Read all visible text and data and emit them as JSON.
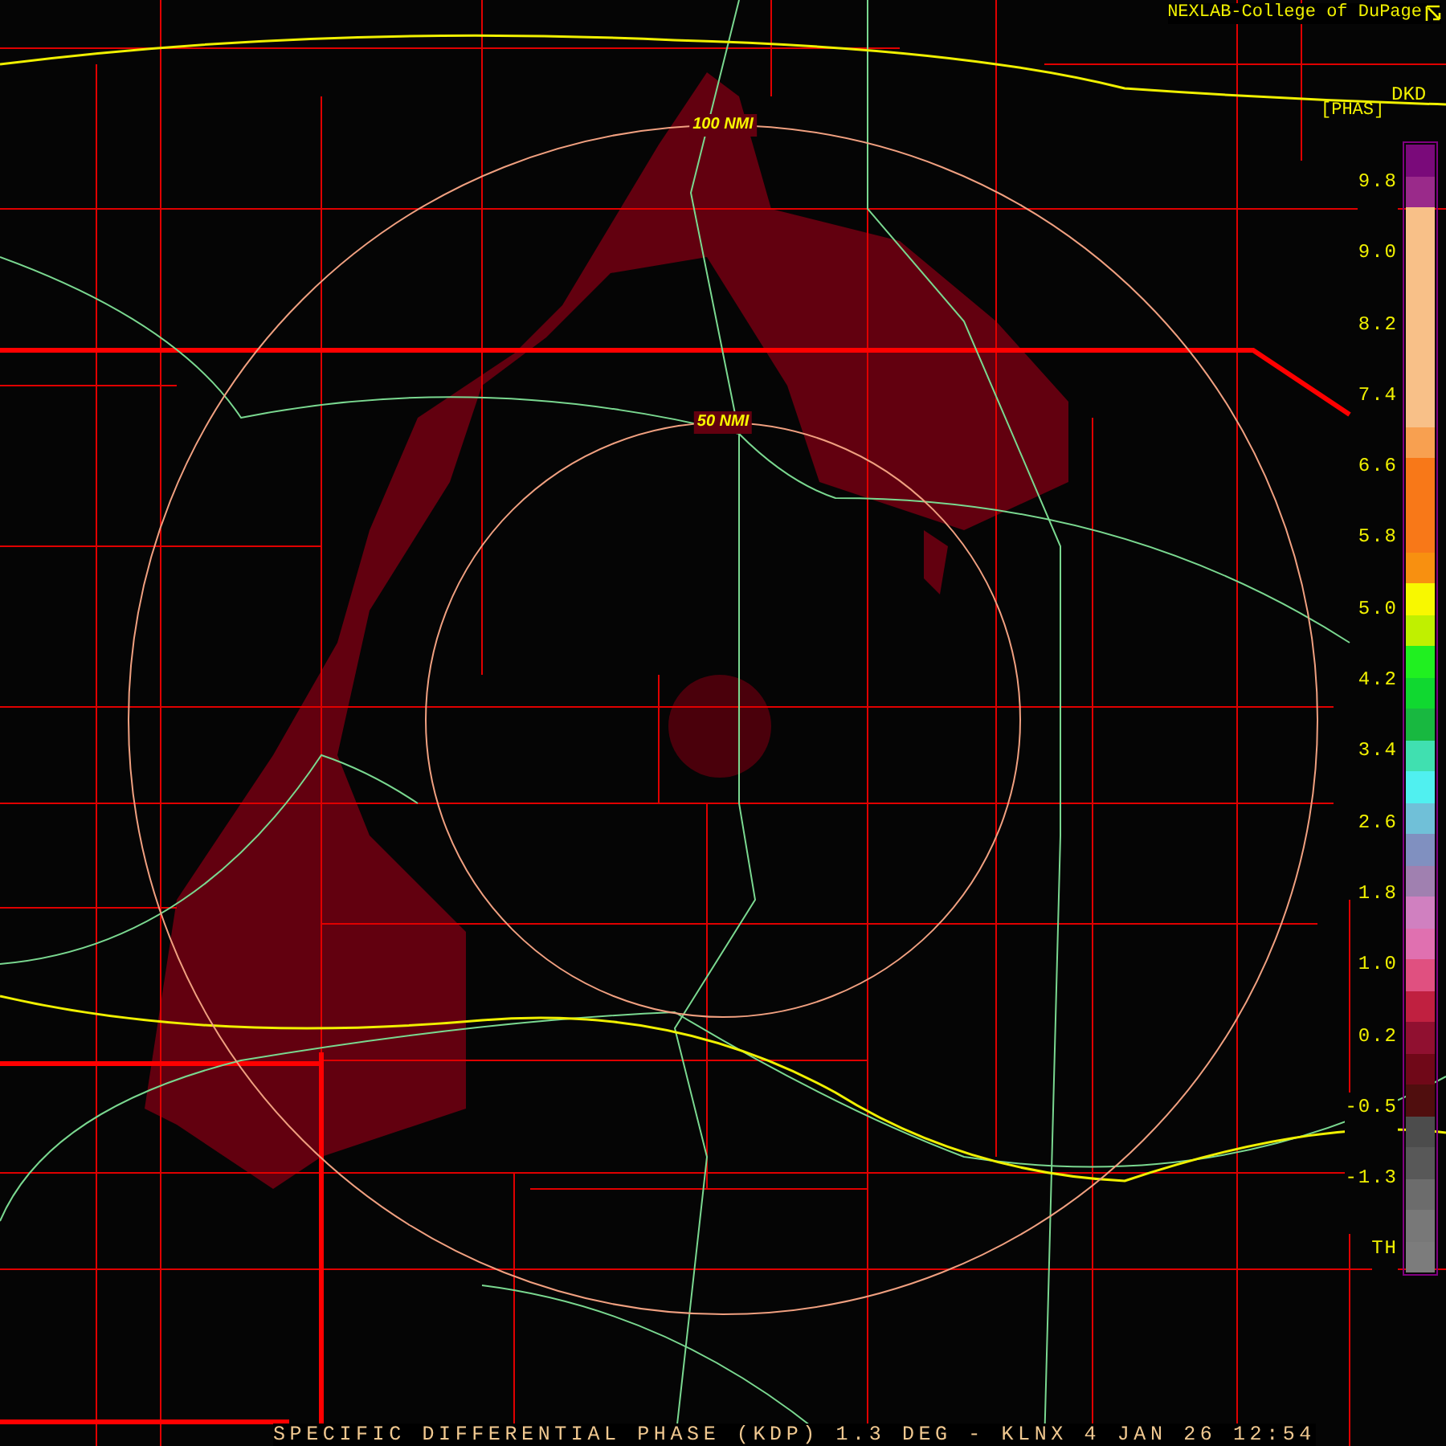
{
  "credit": {
    "text": "NEXLAB-College of DuPage"
  },
  "product": {
    "code": "DKD",
    "units": "[PHAS]"
  },
  "rings": [
    {
      "label": "100 NMI"
    },
    {
      "label": "50 NMI"
    }
  ],
  "legend": {
    "ticks": [
      "9.8",
      "9.0",
      "8.2",
      "7.4",
      "6.6",
      "5.8",
      "5.0",
      "4.2",
      "3.4",
      "2.6",
      "1.8",
      "1.0",
      "0.2",
      "-0.5",
      "-1.3",
      "TH"
    ],
    "swatches": [
      {
        "color": "#7a0a7a"
      },
      {
        "color": "#9a2a8a"
      },
      {
        "color": "#f8c088"
      },
      {
        "color": "#f8c088"
      },
      {
        "color": "#f8c088"
      },
      {
        "color": "#f8c088"
      },
      {
        "color": "#f8c088"
      },
      {
        "color": "#f8c088"
      },
      {
        "color": "#f8c088"
      },
      {
        "color": "#f8a050"
      },
      {
        "color": "#f87818"
      },
      {
        "color": "#f87818"
      },
      {
        "color": "#f87818"
      },
      {
        "color": "#f89010"
      },
      {
        "color": "#f8f800"
      },
      {
        "color": "#c0f000"
      },
      {
        "color": "#20f020"
      },
      {
        "color": "#10d830"
      },
      {
        "color": "#18b840"
      },
      {
        "color": "#40e0b0"
      },
      {
        "color": "#50f0f0"
      },
      {
        "color": "#70c0d8"
      },
      {
        "color": "#8090c0"
      },
      {
        "color": "#a080b0"
      },
      {
        "color": "#d080c0"
      },
      {
        "color": "#e070b0"
      },
      {
        "color": "#e05080"
      },
      {
        "color": "#c02040"
      },
      {
        "color": "#901030"
      },
      {
        "color": "#700818"
      },
      {
        "color": "#500e0e"
      },
      {
        "color": "#4c4c4c"
      },
      {
        "color": "#585858"
      },
      {
        "color": "#6c6c6c"
      },
      {
        "color": "#787878"
      },
      {
        "color": "#7c7c7c"
      }
    ]
  },
  "caption": {
    "text": "SPECIFIC DIFFERENTIAL PHASE (KDP) 1.3 DEG - KLNX 4 JAN 26 12:54"
  }
}
